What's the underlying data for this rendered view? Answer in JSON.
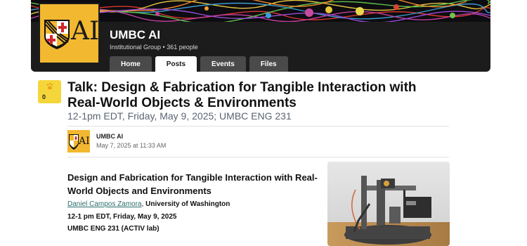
{
  "group": {
    "name": "UMBC AI",
    "meta": "Institutional Group • 361 people",
    "logo_text": "AI",
    "tabs": [
      {
        "label": "Home",
        "active": false
      },
      {
        "label": "Posts",
        "active": true
      },
      {
        "label": "Events",
        "active": false
      },
      {
        "label": "Files",
        "active": false
      }
    ]
  },
  "post": {
    "paw_count": "0",
    "title": "Talk: Design & Fabrication for Tangible Interaction with Real-World Objects & Environments",
    "subtitle": "12-1pm EDT, Friday, May 9, 2025; UMBC ENG 231",
    "author": {
      "name": "UMBC AI",
      "timestamp": "May 7, 2025 at 11:33 AM",
      "avatar_text": "AI"
    },
    "body": {
      "title": "Design and Fabrication for Tangible Interaction with Real-World Objects and Environments",
      "speaker_name": "Daniel Campos Zamora",
      "speaker_suffix": ",",
      "speaker_affiliation": " University of Washington",
      "date": "12-1 pm EDT, Friday, May 9, 2025",
      "room": "UMBC ENG 231 (ACTIV lab)"
    }
  },
  "colors": {
    "logo_gold": "#f2b830",
    "header_bg": "#1c1c1c",
    "paw_badge": "#f5d63a",
    "link": "#2b6e6b"
  }
}
